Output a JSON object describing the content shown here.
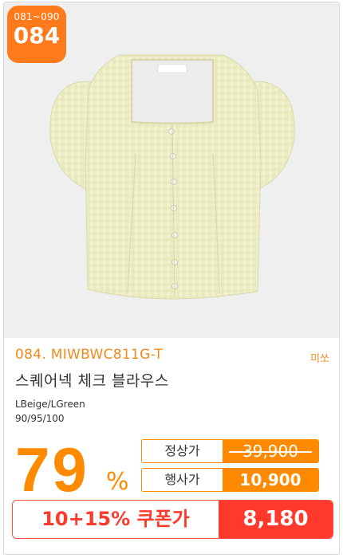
{
  "product": {
    "range_label": "081~090",
    "number": "084",
    "code": "084. MIWBWC811G-T",
    "brand": "미쏘",
    "name": "스퀘어넥 체크 블라우스",
    "color": "LBeige/LGreen",
    "sizes": "90/95/100",
    "discount_value": "79",
    "discount_unit": "%",
    "regular_label": "정상가",
    "regular_price": "39,900",
    "sale_label": "행사가",
    "sale_price": "10,900",
    "coupon_label": "10+15% 쿠폰가",
    "coupon_price": "8,180"
  },
  "colors": {
    "accent_orange": "#ff8a00",
    "coupon_red": "#ff3a2c",
    "photo_bg": "#efefef"
  }
}
